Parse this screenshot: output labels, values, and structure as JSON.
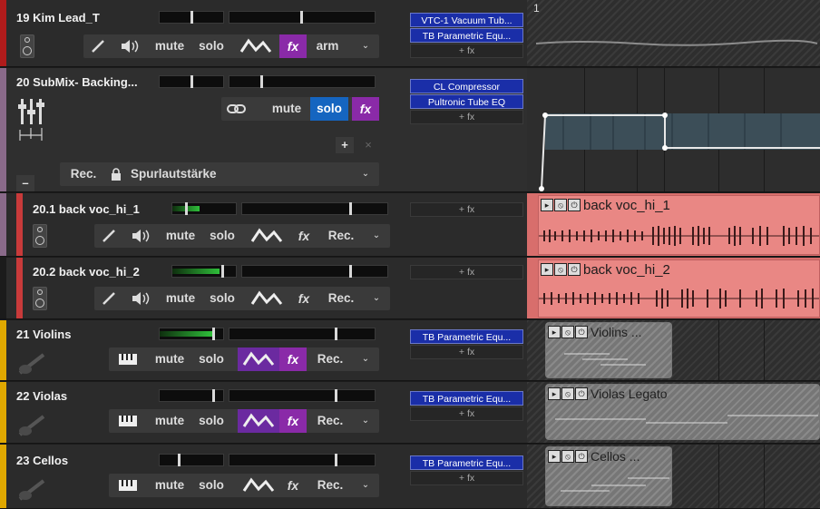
{
  "colors": {
    "track_19": "#b01b1b",
    "track_20": "#8a6a8a",
    "track_20_children": "#c83a3a",
    "track_21_23": "#e0a800",
    "fx_slot": "#1a2ea8",
    "fx_active": "#8a2aa8",
    "solo_active": "#1565c0",
    "item_pink": "#e98784"
  },
  "labels": {
    "mute": "mute",
    "solo": "solo",
    "fx": "fx",
    "arm": "arm",
    "rec": "Rec.",
    "add_fx": "+ fx",
    "volume_env": "Spurlautstärke",
    "add": "+",
    "close": "×",
    "minus": "–",
    "timeline_marker": "1"
  },
  "tracks": [
    {
      "name": "19 Kim Lead_T",
      "fx": [
        "VTC-1 Vacuum Tub...",
        "TB Parametric Equ..."
      ]
    },
    {
      "name": "20 SubMix- Backing...",
      "fx": [
        "CL Compressor",
        "Pultronic Tube EQ"
      ]
    },
    {
      "name": "20.1 back voc_hi_1",
      "fx": [],
      "item": "back voc_hi_1"
    },
    {
      "name": "20.2 back voc_hi_2",
      "fx": [],
      "item": "back voc_hi_2"
    },
    {
      "name": "21 Violins",
      "fx": [
        "TB Parametric Equ..."
      ],
      "item": "Violins ..."
    },
    {
      "name": "22 Violas",
      "fx": [
        "TB Parametric Equ..."
      ],
      "item": "Violas Legato"
    },
    {
      "name": "23 Cellos",
      "fx": [
        "TB Parametric Equ..."
      ],
      "item": "Cellos ..."
    }
  ],
  "icons": {
    "io": "io-routing-icon",
    "phase": "phase-invert-icon",
    "speaker": "speaker-icon",
    "envelope": "envelope-icon",
    "piano": "piano-icon",
    "link": "link-icon",
    "lock": "lock-icon",
    "faders": "faders-icon",
    "instrument": "instrument-icon"
  }
}
